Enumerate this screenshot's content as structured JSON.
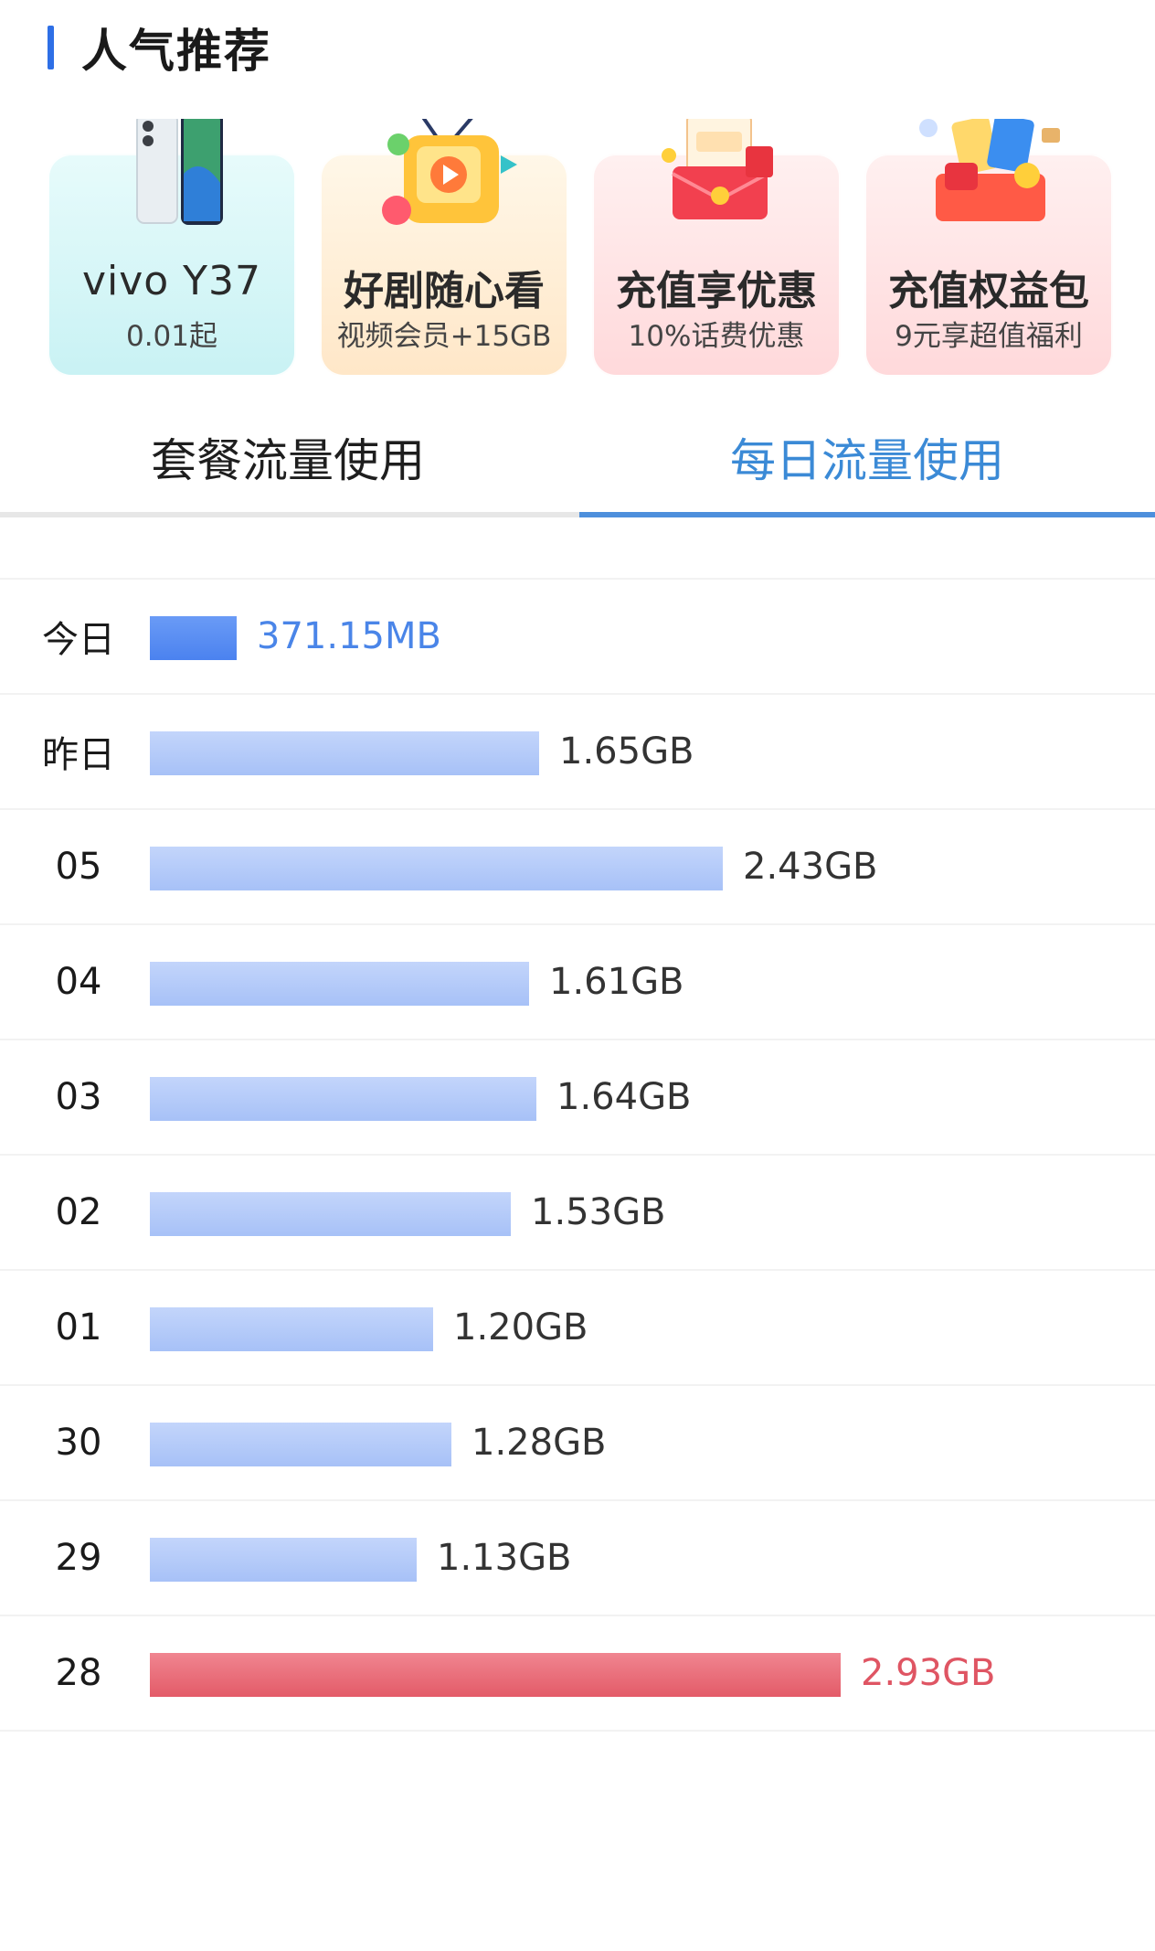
{
  "header": {
    "title": "人气推荐"
  },
  "promos": [
    {
      "title": "vivo Y37",
      "subtitle": "0.01起",
      "icon": "phone-icon"
    },
    {
      "title": "好剧随心看",
      "subtitle": "视频会员+15GB",
      "icon": "tv-icon"
    },
    {
      "title": "充值享优惠",
      "subtitle": "10%话费优惠",
      "icon": "gift-coupon-icon"
    },
    {
      "title": "充值权益包",
      "subtitle": "9元享超值福利",
      "icon": "benefit-pack-icon"
    }
  ],
  "tabs": [
    {
      "label": "套餐流量使用",
      "active": false
    },
    {
      "label": "每日流量使用",
      "active": true
    }
  ],
  "colors": {
    "accent": "#2e6fe6",
    "active_tab": "#3b8ad6",
    "bar": "#a7c1f7",
    "bar_today": "#4b82ef",
    "bar_peak": "#e35b68"
  },
  "daily_usage": [
    {
      "day": "今日",
      "value": "371.15MB",
      "gb": 0.37,
      "kind": "today"
    },
    {
      "day": "昨日",
      "value": "1.65GB",
      "gb": 1.65,
      "kind": "normal"
    },
    {
      "day": "05",
      "value": "2.43GB",
      "gb": 2.43,
      "kind": "normal"
    },
    {
      "day": "04",
      "value": "1.61GB",
      "gb": 1.61,
      "kind": "normal"
    },
    {
      "day": "03",
      "value": "1.64GB",
      "gb": 1.64,
      "kind": "normal"
    },
    {
      "day": "02",
      "value": "1.53GB",
      "gb": 1.53,
      "kind": "normal"
    },
    {
      "day": "01",
      "value": "1.20GB",
      "gb": 1.2,
      "kind": "normal"
    },
    {
      "day": "30",
      "value": "1.28GB",
      "gb": 1.28,
      "kind": "normal"
    },
    {
      "day": "29",
      "value": "1.13GB",
      "gb": 1.13,
      "kind": "normal"
    },
    {
      "day": "28",
      "value": "2.93GB",
      "gb": 2.93,
      "kind": "peak"
    }
  ]
}
